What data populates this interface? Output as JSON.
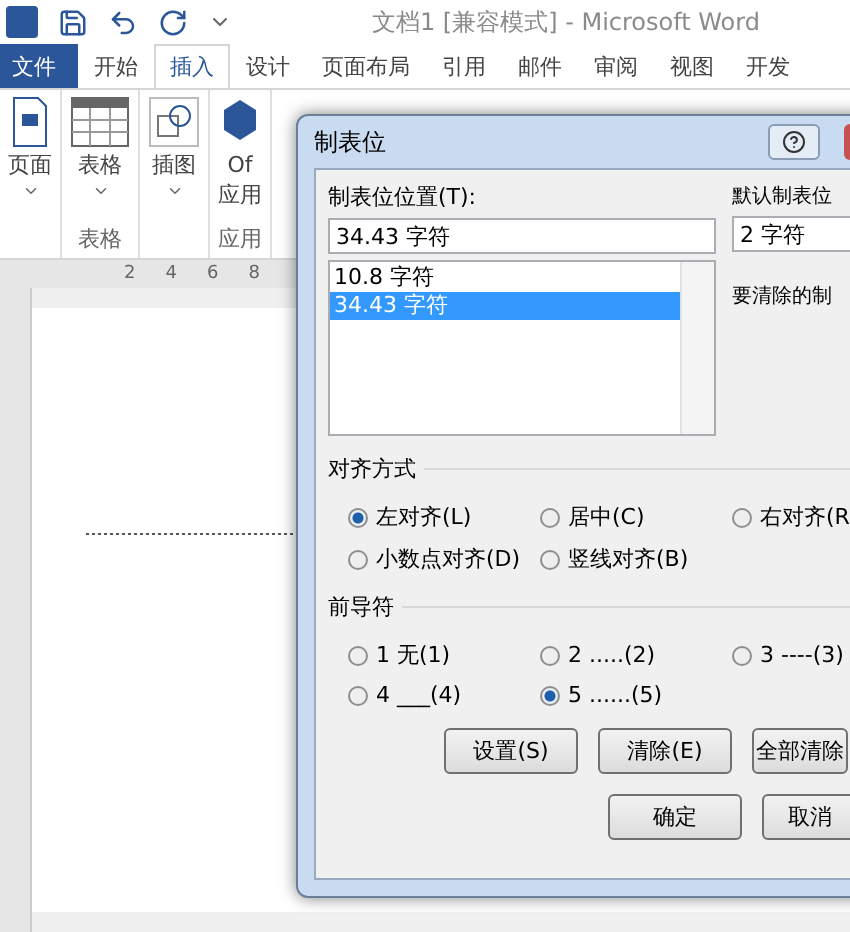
{
  "title_bar": {
    "title": "文档1 [兼容模式] - Microsoft Word"
  },
  "tabs": [
    {
      "label": "文件",
      "kind": "file",
      "selected": false
    },
    {
      "label": "开始",
      "kind": "tab",
      "selected": false
    },
    {
      "label": "插入",
      "kind": "tab",
      "selected": true
    },
    {
      "label": "设计",
      "kind": "tab",
      "selected": false
    },
    {
      "label": "页面布局",
      "kind": "tab",
      "selected": false
    },
    {
      "label": "引用",
      "kind": "tab",
      "selected": false
    },
    {
      "label": "邮件",
      "kind": "tab",
      "selected": false
    },
    {
      "label": "审阅",
      "kind": "tab",
      "selected": false
    },
    {
      "label": "视图",
      "kind": "tab",
      "selected": false
    },
    {
      "label": "开发",
      "kind": "tab",
      "selected": false
    }
  ],
  "ribbon": {
    "groups": [
      {
        "items": [
          {
            "kind": "page",
            "lines": [
              "页面"
            ],
            "dropdown": true
          }
        ]
      },
      {
        "label": "表格",
        "items": [
          {
            "kind": "table",
            "lines": [
              "表格"
            ],
            "dropdown": true
          }
        ]
      },
      {
        "items": [
          {
            "kind": "shapes",
            "lines": [
              "插图"
            ],
            "dropdown": true
          }
        ]
      },
      {
        "label": "应用",
        "items": [
          {
            "kind": "office",
            "lines": [
              "Of",
              "应用"
            ],
            "dropdown": false
          }
        ]
      }
    ]
  },
  "ruler": {
    "numbers": [
      "2",
      "4",
      "6",
      "8"
    ]
  },
  "dialog": {
    "title": "制表位",
    "position_label": "制表位位置(T):",
    "position_value": "34.43 字符",
    "stops": [
      {
        "label": "10.8 字符",
        "selected": false
      },
      {
        "label": "34.43 字符",
        "selected": true
      }
    ],
    "default_label": "默认制表位",
    "default_value": "2 字符",
    "clear_label": "要清除的制",
    "alignment": {
      "title": "对齐方式",
      "options": [
        {
          "label": "左对齐(L)",
          "selected": true
        },
        {
          "label": "居中(C)",
          "selected": false
        },
        {
          "label": "右对齐(R",
          "selected": false
        },
        {
          "label": "小数点对齐(D)",
          "selected": false
        },
        {
          "label": "竖线对齐(B)",
          "selected": false
        }
      ]
    },
    "leader": {
      "title": "前导符",
      "options": [
        {
          "label": "1 无(1)",
          "selected": false
        },
        {
          "label": "2 .....(2)",
          "selected": false
        },
        {
          "label": "3 ----(3)",
          "selected": false
        },
        {
          "label": "4 ___(4)",
          "selected": false
        },
        {
          "label": "5 ......(5)",
          "selected": true
        }
      ]
    },
    "buttons": [
      "设置(S)",
      "清除(E)",
      "全部清除"
    ],
    "bottom_buttons": [
      "确定",
      "取消"
    ]
  }
}
